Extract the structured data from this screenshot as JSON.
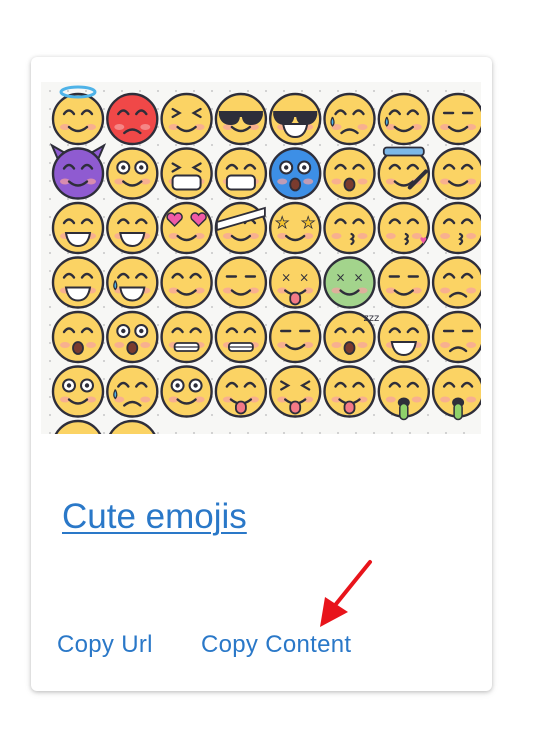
{
  "card": {
    "title": "Cute emojis",
    "image": {
      "description": "sheet-of-cute-emoji-icons",
      "icons": [
        [
          "halo",
          "angry-red",
          "squint",
          "sunglasses",
          "cool-grin",
          "crying",
          "loud-cry",
          "neutral"
        ],
        [
          "devil",
          "dizzy",
          "mask-squint",
          "medical-mask",
          "blue-shocked",
          "surprised",
          "thermometer",
          "smile"
        ],
        [
          "grin",
          "happy",
          "heart-eyes",
          "bandage",
          "star-eyes",
          "kiss",
          "kiss-heart",
          "wink-kiss"
        ],
        [
          "joy",
          "laugh-tears",
          "smile",
          "blank",
          "dead",
          "sick-green",
          "expressionless",
          "relieved"
        ],
        [
          "worried",
          "open-mouth",
          "grimace",
          "zipper",
          "smirk",
          "sleepy",
          "sweat-smile",
          "unamused"
        ],
        [
          "eye-roll",
          "sad-sweat",
          "rolling-eyes",
          "tongue",
          "squint-tongue",
          "wink-tongue",
          "drool",
          "vomit"
        ]
      ]
    },
    "actions": {
      "copy_url": "Copy Url",
      "copy_content": "Copy Content"
    }
  },
  "colors": {
    "link": "#2a78c8",
    "arrow": "#e8141b",
    "emoji_yellow": "#fbd364",
    "outline": "#2e2e3a"
  }
}
